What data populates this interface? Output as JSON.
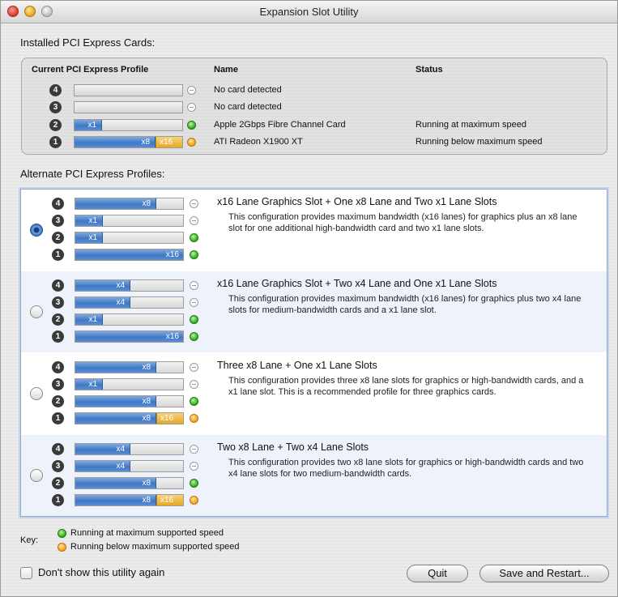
{
  "window": {
    "title": "Expansion Slot Utility"
  },
  "installed": {
    "section_label": "Installed PCI Express Cards:",
    "headers": {
      "profile": "Current PCI Express Profile",
      "name": "Name",
      "status": "Status"
    },
    "rows": [
      {
        "slot": "4",
        "bar_label": "",
        "bar_fill": 0,
        "extra_label": "",
        "indicator": "empty",
        "name": "No card detected",
        "status": ""
      },
      {
        "slot": "3",
        "bar_label": "",
        "bar_fill": 0,
        "extra_label": "",
        "indicator": "empty",
        "name": "No card detected",
        "status": ""
      },
      {
        "slot": "2",
        "bar_label": "x1",
        "bar_fill": 0.25,
        "extra_label": "",
        "indicator": "green",
        "name": "Apple 2Gbps Fibre Channel Card",
        "status": "Running at maximum speed"
      },
      {
        "slot": "1",
        "bar_label": "x8",
        "bar_fill": 0.74,
        "extra_label": "x16",
        "indicator": "orange",
        "name": "ATI Radeon X1900 XT",
        "status": "Running below maximum speed"
      }
    ]
  },
  "alternate": {
    "section_label": "Alternate PCI Express Profiles:",
    "profiles": [
      {
        "selected": true,
        "title": "x16 Lane Graphics Slot + One x8 Lane and Two x1 Lane Slots",
        "description": "This configuration provides maximum bandwidth (x16 lanes) for graphics plus an x8 lane slot for one additional high-bandwidth card and two x1 lane slots.",
        "slots": [
          {
            "num": "4",
            "label": "x8",
            "fill": 0.74,
            "extra": "",
            "indicator": "empty"
          },
          {
            "num": "3",
            "label": "x1",
            "fill": 0.25,
            "extra": "",
            "indicator": "empty"
          },
          {
            "num": "2",
            "label": "x1",
            "fill": 0.25,
            "extra": "",
            "indicator": "green"
          },
          {
            "num": "1",
            "label": "x16",
            "fill": 1.0,
            "extra": "",
            "indicator": "green"
          }
        ]
      },
      {
        "selected": false,
        "title": "x16 Lane Graphics Slot + Two x4 Lane and One x1 Lane Slots",
        "description": "This configuration provides maximum bandwidth (x16 lanes) for graphics plus two x4 lane slots for medium-bandwidth cards and a x1 lane slot.",
        "slots": [
          {
            "num": "4",
            "label": "x4",
            "fill": 0.5,
            "extra": "",
            "indicator": "empty"
          },
          {
            "num": "3",
            "label": "x4",
            "fill": 0.5,
            "extra": "",
            "indicator": "empty"
          },
          {
            "num": "2",
            "label": "x1",
            "fill": 0.25,
            "extra": "",
            "indicator": "green"
          },
          {
            "num": "1",
            "label": "x16",
            "fill": 1.0,
            "extra": "",
            "indicator": "green"
          }
        ]
      },
      {
        "selected": false,
        "title": "Three x8 Lane + One x1 Lane Slots",
        "description": "This configuration provides three x8 lane slots for graphics or high-bandwidth cards, and a x1 lane slot.  This is a recommended profile for three graphics cards.",
        "slots": [
          {
            "num": "4",
            "label": "x8",
            "fill": 0.74,
            "extra": "",
            "indicator": "empty"
          },
          {
            "num": "3",
            "label": "x1",
            "fill": 0.25,
            "extra": "",
            "indicator": "empty"
          },
          {
            "num": "2",
            "label": "x8",
            "fill": 0.74,
            "extra": "",
            "indicator": "green"
          },
          {
            "num": "1",
            "label": "x8",
            "fill": 0.74,
            "extra": "x16",
            "indicator": "orange"
          }
        ]
      },
      {
        "selected": false,
        "title": "Two x8 Lane + Two x4 Lane Slots",
        "description": "This configuration provides two x8 lane slots for graphics or high-bandwidth cards and two x4 lane slots for two medium-bandwidth cards.",
        "slots": [
          {
            "num": "4",
            "label": "x4",
            "fill": 0.5,
            "extra": "",
            "indicator": "empty"
          },
          {
            "num": "3",
            "label": "x4",
            "fill": 0.5,
            "extra": "",
            "indicator": "empty"
          },
          {
            "num": "2",
            "label": "x8",
            "fill": 0.74,
            "extra": "",
            "indicator": "green"
          },
          {
            "num": "1",
            "label": "x8",
            "fill": 0.74,
            "extra": "x16",
            "indicator": "orange"
          }
        ]
      }
    ]
  },
  "key": {
    "label": "Key:",
    "green": "Running at maximum supported speed",
    "orange": "Running below maximum supported speed"
  },
  "footer": {
    "checkbox_label": "Don't show this utility again",
    "checkbox_checked": false,
    "quit_label": "Quit",
    "save_label": "Save and Restart..."
  },
  "colors": {
    "lane_fill": "#3f78c4",
    "extra_fill": "#e6a725",
    "led_green": "#2fa81c",
    "led_orange": "#f0a017"
  }
}
